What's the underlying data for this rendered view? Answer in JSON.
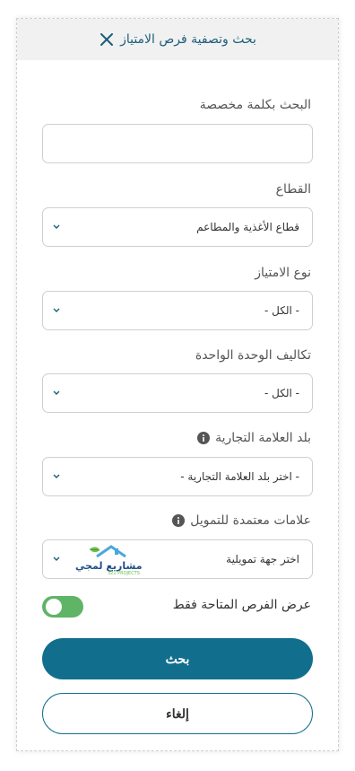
{
  "header": {
    "title": "بحث وتصفية فرص الامتياز",
    "close_icon": "close-icon"
  },
  "keyword": {
    "label": "البحث بكلمة مخصصة",
    "value": "",
    "placeholder": ""
  },
  "sector": {
    "label": "القطاع",
    "value": "قطاع الأغذية والمطاعم"
  },
  "franchise_type": {
    "label": "نوع الامتياز",
    "value": "- الكل -"
  },
  "unit_cost": {
    "label": "تكاليف الوحدة الواحدة",
    "value": "- الكل -"
  },
  "brand_country": {
    "label": "بلد العلامة التجارية",
    "value": "- اختر بلد العلامة التجارية -"
  },
  "financing": {
    "label": "علامات معتمدة للتمويل",
    "value": "اختر جهة تمويلية",
    "logo_text": "مشاريع لمجي",
    "logo_subtext": "321 PROJECTS"
  },
  "available_only": {
    "label": "عرض الفرص المتاحة فقط",
    "enabled": true
  },
  "actions": {
    "search": "بحث",
    "cancel": "إلغاء"
  },
  "colors": {
    "primary": "#116f8d",
    "toggle": "#5fb466",
    "header_bg": "#f1f1f1"
  }
}
